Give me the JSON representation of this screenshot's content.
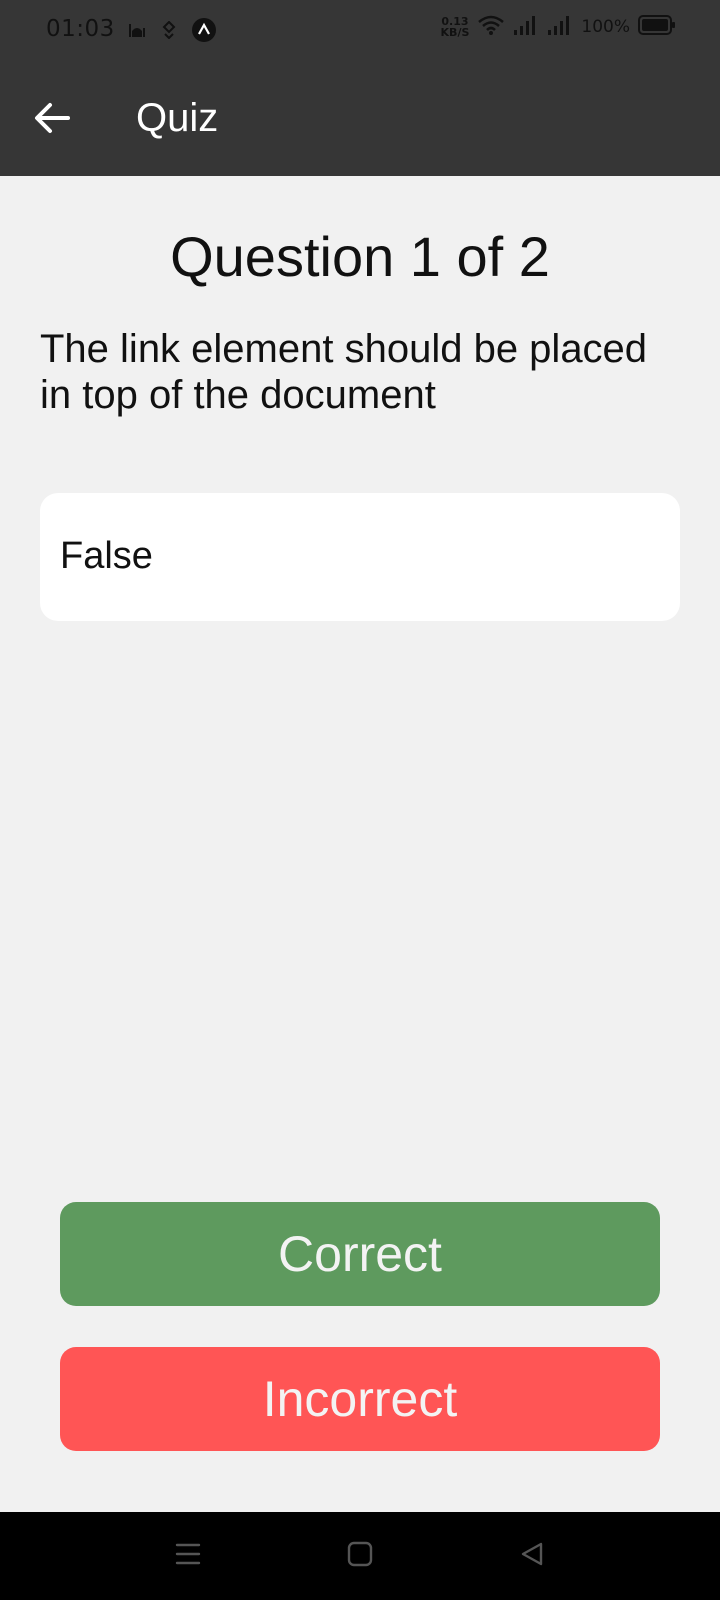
{
  "status_bar": {
    "time": "01:03",
    "net_speed_value": "0.13",
    "net_speed_unit": "KB/S",
    "battery_percent": "100%",
    "icons": [
      "mosque-icon",
      "location-icon",
      "app-a-icon",
      "wifi-icon",
      "signal-icon-1",
      "signal-icon-2",
      "battery-icon"
    ]
  },
  "app_bar": {
    "title": "Quiz",
    "back_icon": "arrow-left-icon"
  },
  "quiz": {
    "heading": "Question 1 of 2",
    "question": "The link element should be placed in top of the document",
    "answer": "False"
  },
  "actions": {
    "correct_label": "Correct",
    "incorrect_label": "Incorrect"
  },
  "colors": {
    "app_bar": "#363636",
    "background": "#f1f1f1",
    "correct": "#5e9a5e",
    "incorrect": "#ff5555"
  },
  "nav_bar": {
    "icons": [
      "menu-icon",
      "home-icon",
      "back-triangle-icon"
    ]
  }
}
